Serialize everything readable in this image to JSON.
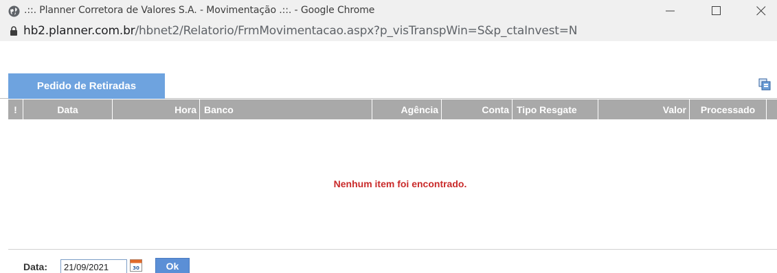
{
  "window": {
    "title": ".::. Planner Corretora de Valores S.A. - Movimentação .::. - Google Chrome",
    "url_domain": "hb2.planner.com.br",
    "url_path": "/hbnet2/Relatorio/FrmMovimentacao.aspx?p_visTranspWin=S&p_ctaInvest=N"
  },
  "tabs": [
    {
      "label": "Pedido de Retiradas",
      "active": true
    }
  ],
  "table": {
    "columns": [
      "!",
      "Data",
      "Hora",
      "Banco",
      "Agência",
      "Conta",
      "Tipo Resgate",
      "Valor",
      "Processado"
    ],
    "rows": [],
    "empty_message": "Nenhum item foi encontrado."
  },
  "filter": {
    "date_label": "Data:",
    "date_value": "21/09/2021",
    "ok_label": "Ok",
    "calendar_icon_text": "30"
  },
  "colors": {
    "tab_active": "#6ea3df",
    "header_bg": "#a9a9a9",
    "empty_message": "#c92a2a",
    "ok_button": "#5b8fd6"
  },
  "icons": {
    "title": "globe-icon",
    "url": "lock-icon",
    "export": "copy-icon",
    "date_picker": "calendar-icon"
  }
}
